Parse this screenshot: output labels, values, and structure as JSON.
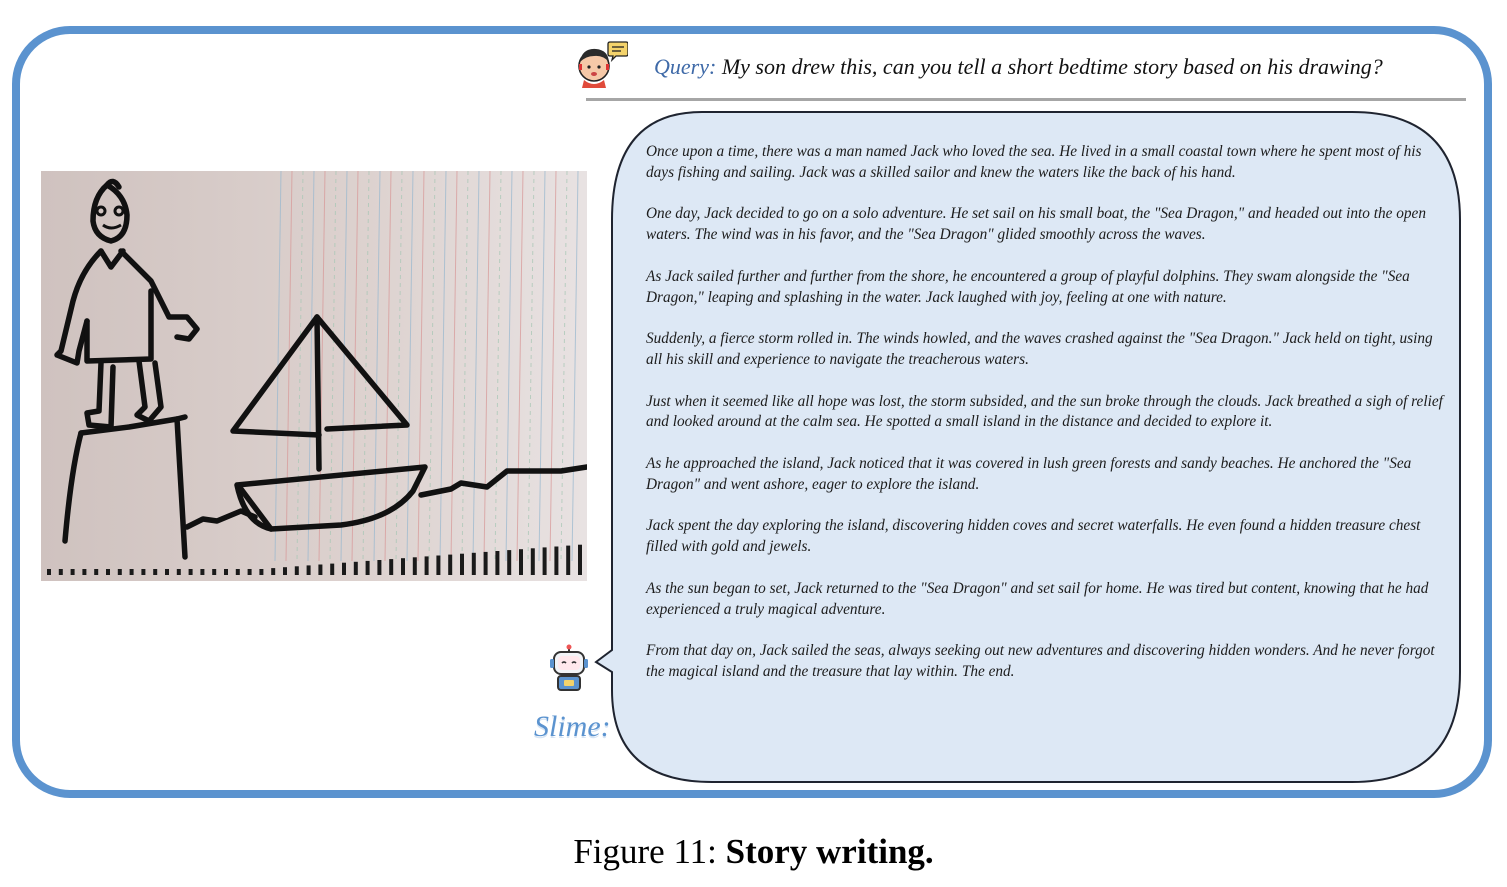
{
  "query": {
    "label": "Query:",
    "text": " My son drew this, can you tell a short bedtime story based on his drawing?"
  },
  "response": {
    "speaker": "Slime:",
    "paragraphs": [
      "Once upon a time, there was a man named Jack who loved the sea. He lived in a small coastal town where he spent most of his days fishing and sailing. Jack was a skilled sailor and knew the waters like the back of his hand.",
      "One day, Jack decided to go on a solo adventure. He set sail on his small boat, the \"Sea Dragon,\" and headed out into the open waters. The wind was in his favor, and the \"Sea Dragon\" glided smoothly across the waves.",
      "As Jack sailed further and further from the shore, he encountered a group of playful dolphins. They swam alongside the \"Sea Dragon,\" leaping and splashing in the water. Jack laughed with joy, feeling at one with nature.",
      "Suddenly, a fierce storm rolled in. The winds howled, and the waves crashed against the \"Sea Dragon.\" Jack held on tight, using all his skill and experience to navigate the treacherous waters.",
      "Just when it seemed like all hope was lost, the storm subsided, and the sun broke through the clouds. Jack breathed a sigh of relief and looked around at the calm sea. He spotted a small island in the distance and decided to explore it.",
      "As he approached the island, Jack noticed that it was covered in lush green forests and sandy beaches. He anchored the \"Sea Dragon\" and went ashore, eager to explore the island.",
      "Jack spent the day exploring the island, discovering hidden coves and secret waterfalls. He even found a hidden treasure chest filled with gold and jewels.",
      "As the sun began to set, Jack returned to the \"Sea Dragon\" and set sail for home. He was tired but content, knowing that he had experienced a truly magical adventure.",
      "From that day on, Jack sailed the seas, always seeking out new adventures and discovering hidden wonders. And he never forgot the magical island and the treasure that lay within. The end."
    ]
  },
  "caption": {
    "prefix": "Figure 11: ",
    "title": "Story writing."
  },
  "colors": {
    "frame": "#5b93cf",
    "bubble_fill": "#dde8f5",
    "query_label": "#3f6aa8",
    "drawing_paper": "#ddd2cf"
  },
  "icons": {
    "user": "boy-speech-bubble-icon",
    "bot": "robot-icon"
  }
}
